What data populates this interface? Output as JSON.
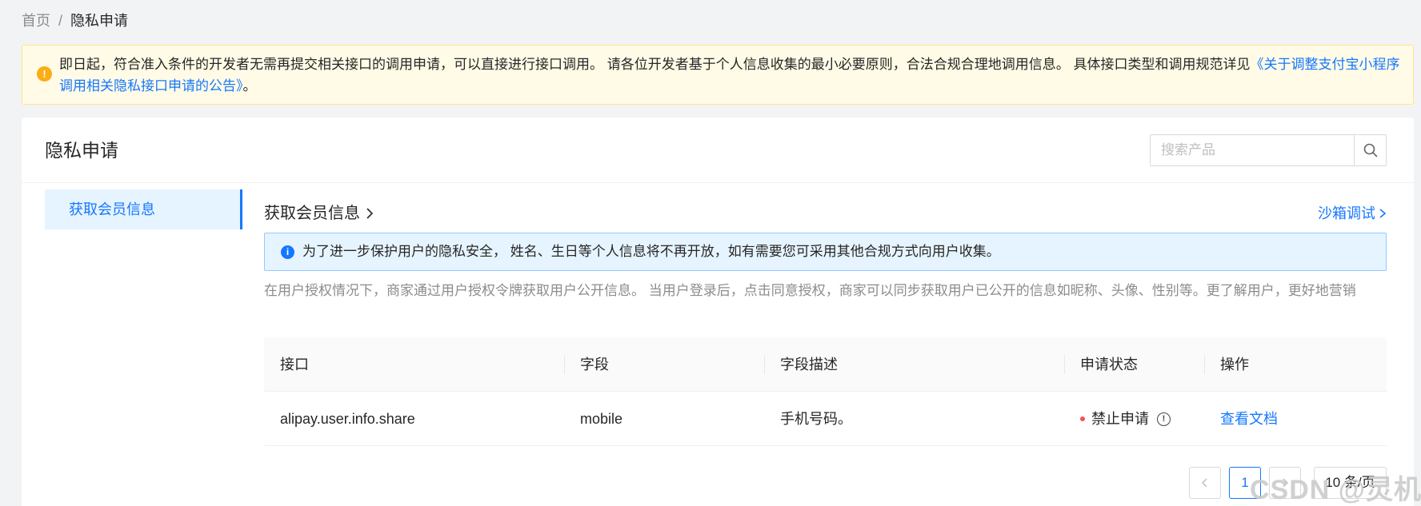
{
  "breadcrumb": {
    "home": "首页",
    "separator": "/",
    "current": "隐私申请"
  },
  "notice": {
    "text": "即日起，符合准入条件的开发者无需再提交相关接口的调用申请，可以直接进行接口调用。 请各位开发者基于个人信息收集的最小必要原则，合法合规合理地调用信息。 具体接口类型和调用规范详见",
    "link": "《关于调整支付宝小程序调用相关隐私接口申请的公告》",
    "suffix": "。"
  },
  "card": {
    "title": "隐私申请"
  },
  "search": {
    "placeholder": "搜索产品"
  },
  "side_nav": {
    "items": [
      {
        "label": "获取会员信息"
      }
    ]
  },
  "section": {
    "title": "获取会员信息",
    "sandbox_link": "沙箱调试"
  },
  "info_banner": {
    "text": "为了进一步保护用户的隐私安全， 姓名、生日等个人信息将不再开放，如有需要您可采用其他合规方式向用户收集。"
  },
  "description": "在用户授权情况下，商家通过用户授权令牌获取用户公开信息。 当用户登录后，点击同意授权，商家可以同步获取用户已公开的信息如昵称、头像、性别等。更了解用户，更好地营销",
  "table": {
    "columns": [
      "接口",
      "字段",
      "字段描述",
      "申请状态",
      "操作"
    ],
    "rows": [
      {
        "api": "alipay.user.info.share",
        "field": "mobile",
        "field_desc": "手机号码。",
        "status": "禁止申请",
        "action": "查看文档"
      }
    ]
  },
  "pagination": {
    "current_page": "1",
    "page_size": "10 条/页"
  },
  "watermark": "CSDN @灵机",
  "colors": {
    "primary": "#1677ff",
    "warning": "#faad14",
    "error": "#ff4d4f"
  }
}
